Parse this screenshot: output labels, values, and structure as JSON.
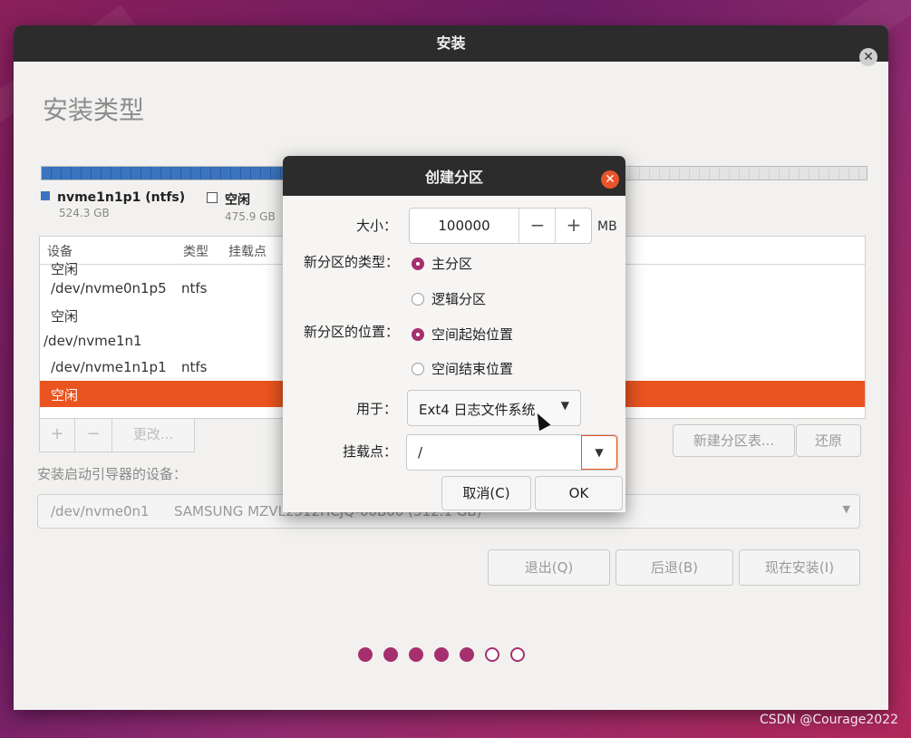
{
  "window": {
    "title": "安装",
    "heading": "安装类型"
  },
  "legend": [
    {
      "label": "nvme1n1p1 (ntfs)",
      "size": "524.3 GB"
    },
    {
      "label": "空闲",
      "size": "475.9 GB"
    }
  ],
  "table": {
    "headers": [
      "设备",
      "类型",
      "挂载点"
    ],
    "rows": [
      {
        "device": "空闲",
        "type": ""
      },
      {
        "device": "/dev/nvme0n1p5",
        "type": "ntfs"
      },
      {
        "device": "空闲",
        "type": ""
      },
      {
        "device": "/dev/nvme1n1",
        "type": ""
      },
      {
        "device": "/dev/nvme1n1p1",
        "type": "ntfs"
      },
      {
        "device": "空闲",
        "type": ""
      }
    ]
  },
  "toolbar": {
    "add": "+",
    "remove": "−",
    "change": "更改..."
  },
  "buttons": {
    "new_table": "新建分区表...",
    "revert": "还原",
    "quit": "退出(Q)",
    "back": "后退(B)",
    "install": "现在安装(I)"
  },
  "bootloader": {
    "label": "安装启动引导器的设备：",
    "device": "/dev/nvme0n1",
    "model": "SAMSUNG MZVL2512HCJQ-00B00 (512.1 GB)"
  },
  "dialog": {
    "title": "创建分区",
    "size_label": "大小：",
    "size_value": "100000",
    "minus": "−",
    "plus": "+",
    "unit": "MB",
    "type_label": "新分区的类型：",
    "type_primary": "主分区",
    "type_logical": "逻辑分区",
    "location_label": "新分区的位置：",
    "location_start": "空间起始位置",
    "location_end": "空间结束位置",
    "use_label": "用于：",
    "use_value": "Ext4 日志文件系统",
    "mount_label": "挂载点：",
    "mount_value": "/",
    "cancel": "取消(C)",
    "ok": "OK"
  },
  "progress": {
    "completed_steps": 5,
    "total_steps": 7
  },
  "watermark": "CSDN @Courage2022",
  "colors": {
    "accent": "#e95420",
    "dot": "#a5306d",
    "bar": "#3a74c0"
  }
}
